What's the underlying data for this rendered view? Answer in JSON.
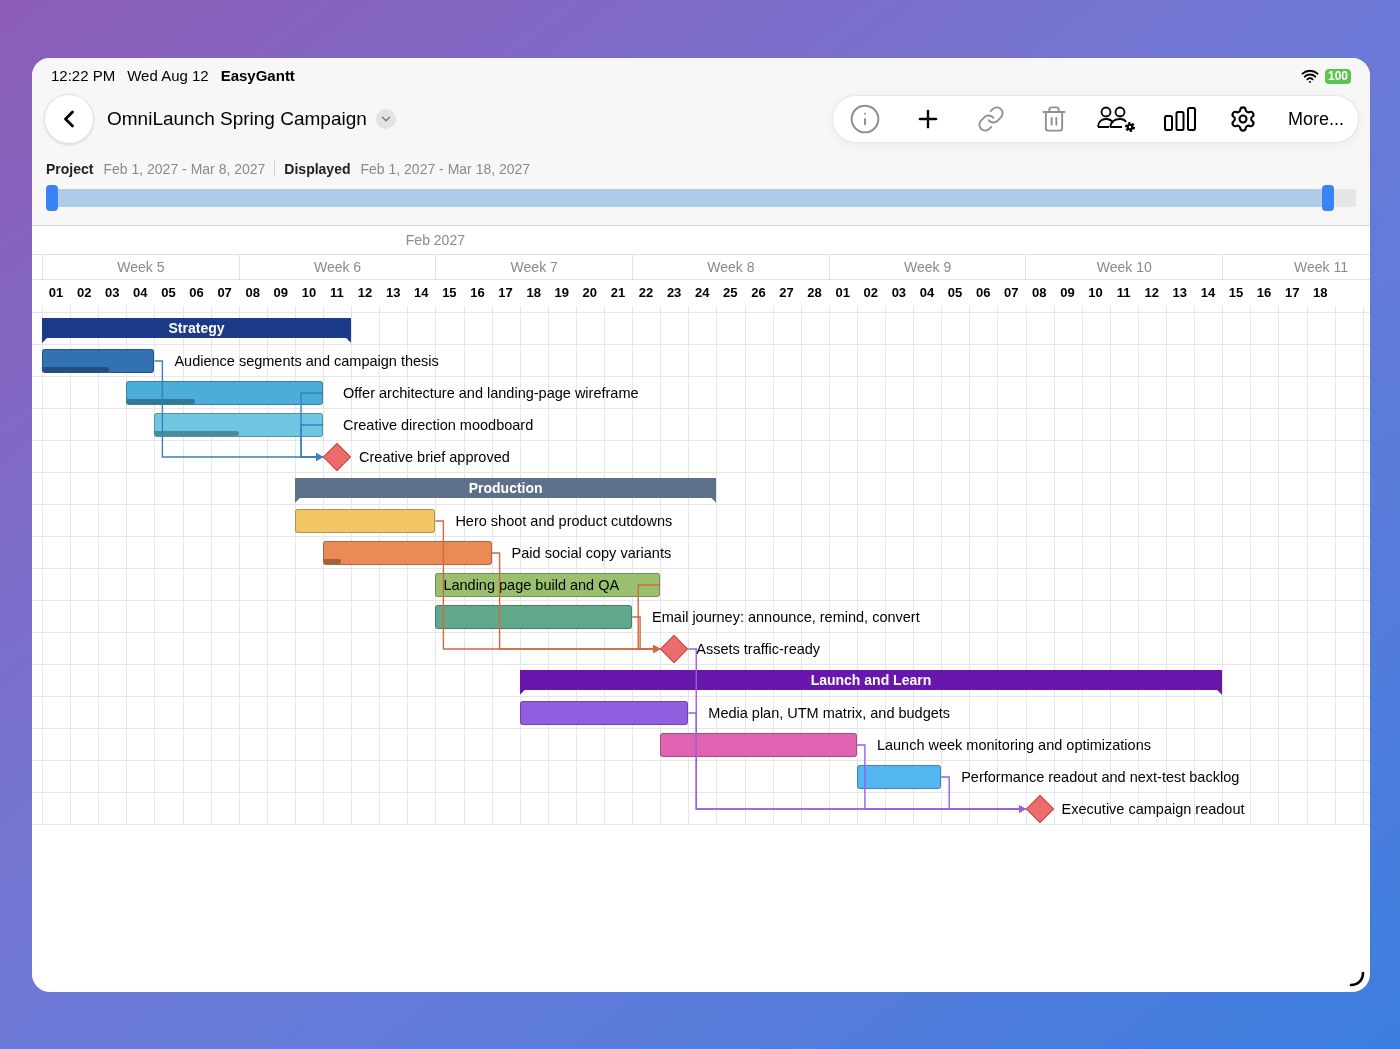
{
  "status_bar": {
    "time": "12:22 PM",
    "date": "Wed Aug 12",
    "app": "EasyGantt",
    "battery": "100"
  },
  "header": {
    "title": "OmniLaunch Spring Campaign",
    "project_label": "Project",
    "project_range": "Feb 1, 2027 - Mar 8, 2027",
    "displayed_label": "Displayed",
    "displayed_range": "Feb 1, 2027 - Mar 18, 2027",
    "range_slider": {
      "level": 0.979
    }
  },
  "toolbar": [
    {
      "kind": "info",
      "disabled": true
    },
    {
      "kind": "add",
      "disabled": false
    },
    {
      "kind": "link",
      "disabled": true
    },
    {
      "kind": "delete",
      "disabled": true
    },
    {
      "kind": "people",
      "disabled": false
    },
    {
      "kind": "columns",
      "disabled": false
    },
    {
      "kind": "settings",
      "disabled": false
    },
    {
      "kind": "text",
      "label": "More...",
      "disabled": false
    }
  ],
  "timeline": {
    "month": "Feb 2027",
    "weeks": [
      "Week 5",
      "Week 6",
      "Week 7",
      "Week 8",
      "Week 9",
      "Week 10",
      "Week 11"
    ],
    "days": [
      "01",
      "02",
      "03",
      "04",
      "05",
      "06",
      "07",
      "08",
      "09",
      "10",
      "11",
      "12",
      "13",
      "14",
      "15",
      "16",
      "17",
      "18",
      "19",
      "20",
      "21",
      "22",
      "23",
      "24",
      "25",
      "26",
      "27",
      "28",
      "01",
      "02",
      "03",
      "04",
      "05",
      "06",
      "07",
      "08",
      "09",
      "10",
      "11",
      "12",
      "13",
      "14",
      "15",
      "16",
      "17",
      "18"
    ]
  },
  "groups": [
    {
      "name": "Strategy",
      "color": "#1b3a87",
      "items": [
        {
          "kind": "task",
          "name": "Audience segments and campaign thesis",
          "color": "#3372b2",
          "level": 0.6,
          "linked": true,
          "label_inside": false
        },
        {
          "kind": "task",
          "name": "Offer architecture and landing-page wireframe",
          "color": "#4aaed8",
          "level": 0.35,
          "linked": true,
          "label_inside": false
        },
        {
          "kind": "task",
          "name": "Creative direction moodboard",
          "color": "#6fc6e0",
          "level": 0.5,
          "linked": true,
          "label_inside": false
        },
        {
          "kind": "milestone",
          "name": "Creative brief approved",
          "color": "#ec6b6b"
        }
      ]
    },
    {
      "name": "Production",
      "color": "#5d7089",
      "items": [
        {
          "kind": "task",
          "name": "Hero shoot and product cutdowns",
          "color": "#f2c664",
          "linked": true,
          "label_inside": false
        },
        {
          "kind": "task",
          "name": "Paid social copy variants",
          "color": "#ea8a56",
          "level": 0.1,
          "linked": true,
          "label_inside": false
        },
        {
          "kind": "task",
          "name": "Landing page build and QA",
          "color": "#99c06e",
          "linked": true,
          "label_inside": true
        },
        {
          "kind": "task",
          "name": "Email journey: announce, remind, convert",
          "color": "#5fa98a",
          "linked": true,
          "label_inside": false
        },
        {
          "kind": "milestone",
          "name": "Assets traffic-ready",
          "color": "#ec6b6b",
          "linked": true
        }
      ]
    },
    {
      "name": "Launch and Learn",
      "color": "#6817ac",
      "items": [
        {
          "kind": "task",
          "name": "Media plan, UTM matrix, and budgets",
          "color": "#8f5fe0",
          "linked": true,
          "label_inside": false
        },
        {
          "kind": "task",
          "name": "Launch week monitoring and optimizations",
          "color": "#df63b0",
          "linked": true,
          "label_inside": false
        },
        {
          "kind": "task",
          "name": "Performance readout and next-test backlog",
          "color": "#53b6f0",
          "linked": true,
          "label_inside": false
        },
        {
          "kind": "milestone",
          "name": "Executive campaign readout",
          "color": "#ec6b6b"
        }
      ]
    }
  ]
}
